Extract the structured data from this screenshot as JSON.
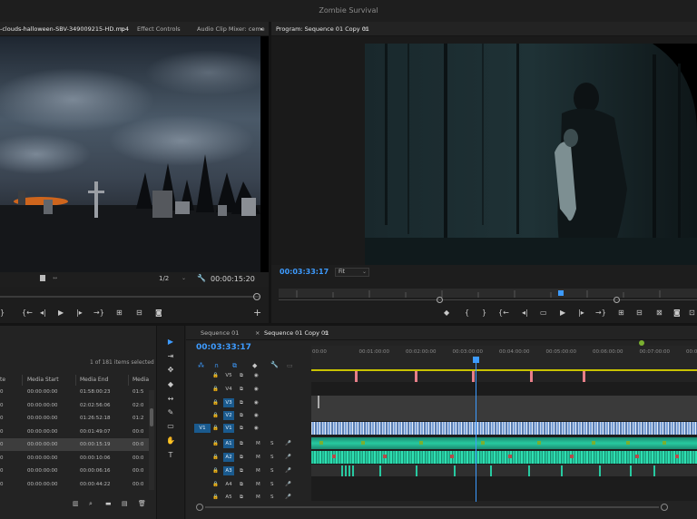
{
  "window": {
    "title": "Zombie Survival"
  },
  "source_panel": {
    "tabs": [
      "-clouds-halloween-SBV-349009215-HD.mp4",
      "Effect Controls",
      "Audio Clip Mixer: ceme"
    ],
    "menu_glyph": "≡",
    "more_glyph": "»",
    "zoom": "1/2",
    "timecode": "00:00:15:20"
  },
  "program_panel": {
    "title": "Program: Sequence 01 Copy 01",
    "menu_glyph": "≡",
    "timecode": "00:03:33:17",
    "fit": "Fit"
  },
  "project_panel": {
    "selection_info": "1 of 181 items selected",
    "columns": [
      "te",
      "Media Start",
      "Media End",
      "Media"
    ],
    "rows": [
      {
        "a": "0",
        "start": "00:00:00:00",
        "end": "01:58:00:23",
        "c": "01:5"
      },
      {
        "a": "0",
        "start": "00:00:00:00",
        "end": "02:02:56:06",
        "c": "02:0"
      },
      {
        "a": "0",
        "start": "00:00:00:00",
        "end": "01:26:52:18",
        "c": "01:2"
      },
      {
        "a": "0",
        "start": "00:00:00:00",
        "end": "00:01:49:07",
        "c": "00:0"
      },
      {
        "a": "0",
        "start": "00:00:00:00",
        "end": "00:00:15:19",
        "c": "00:0"
      },
      {
        "a": "0",
        "start": "00:00:00:00",
        "end": "00:00:10:06",
        "c": "00:0"
      },
      {
        "a": "0",
        "start": "00:00:00:00",
        "end": "00:00:06:16",
        "c": "00:0"
      },
      {
        "a": "0",
        "start": "00:00:00:00",
        "end": "00:00:44:22",
        "c": "00:0"
      }
    ]
  },
  "timeline": {
    "tabs": [
      "Sequence 01",
      "Sequence 01 Copy 01"
    ],
    "close_glyph": "×",
    "menu_glyph": "≡",
    "timecode": "00:03:33:17",
    "ruler": [
      "00:00",
      "00:01:00:00",
      "00:02:00:00",
      "00:03:00:00",
      "00:04:00:00",
      "00:05:00:00",
      "00:06:00:00",
      "00:07:00:00",
      "00:08:00"
    ],
    "video_tracks": [
      "V5",
      "V4",
      "V3",
      "V2",
      "V1"
    ],
    "audio_tracks": [
      "A1",
      "A2",
      "A3",
      "A4",
      "A5"
    ],
    "source_patch": "V1",
    "mute": "M",
    "solo": "S"
  },
  "tools": [
    "▶",
    "⇥",
    "✥",
    "◆",
    "↔",
    "✎",
    "▭",
    "✋",
    "T"
  ]
}
